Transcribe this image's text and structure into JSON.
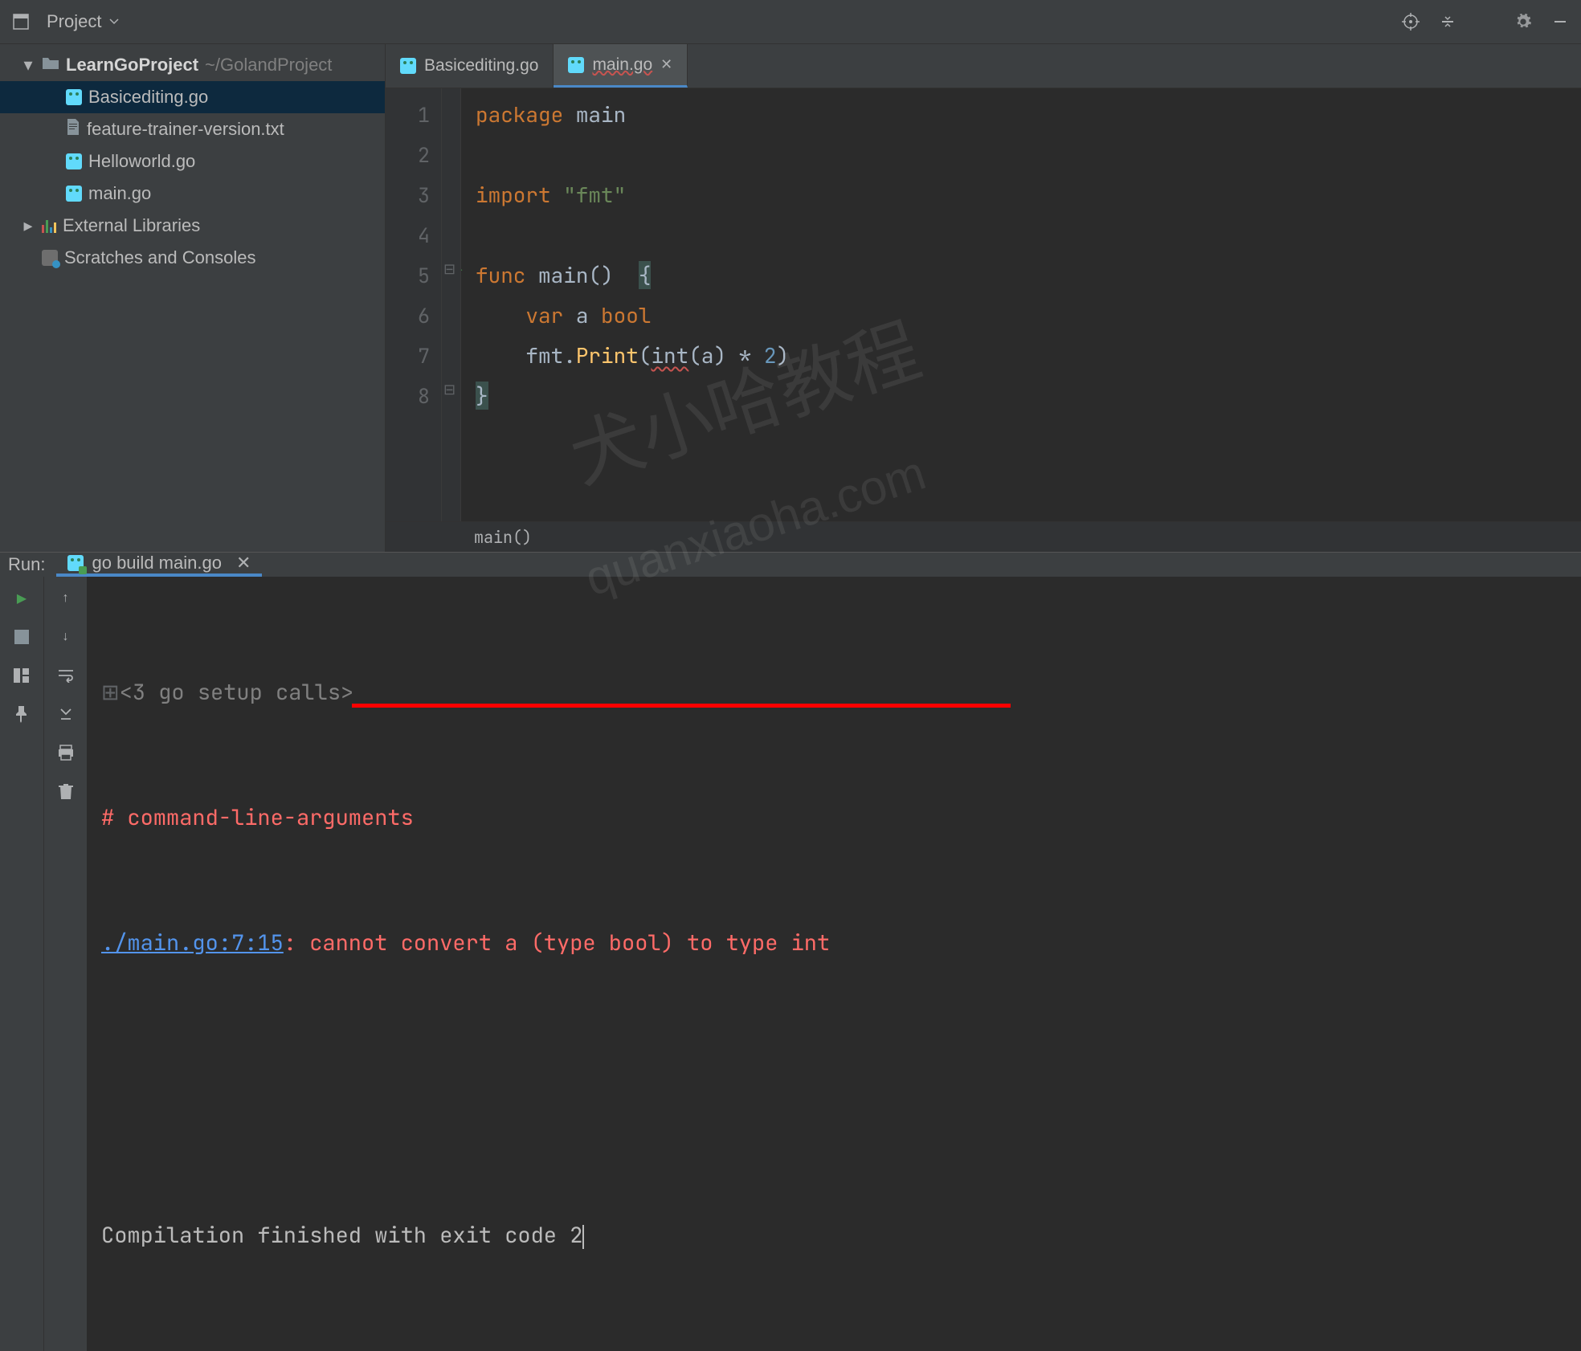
{
  "toolbar": {
    "project_label": "Project"
  },
  "tree": {
    "root": {
      "name": "LearnGoProject",
      "hint": "~/GolandProject"
    },
    "files": [
      {
        "name": "Basicediting.go",
        "type": "go",
        "selected": true
      },
      {
        "name": "feature-trainer-version.txt",
        "type": "txt",
        "selected": false
      },
      {
        "name": "Helloworld.go",
        "type": "go",
        "selected": false
      },
      {
        "name": "main.go",
        "type": "go",
        "selected": false
      }
    ],
    "ext_lib": "External Libraries",
    "scratches": "Scratches and Consoles"
  },
  "tabs": [
    {
      "name": "Basicediting.go",
      "active": false
    },
    {
      "name": "main.go",
      "active": true
    }
  ],
  "code": {
    "lines": [
      {
        "n": 1,
        "tokens": [
          [
            "kw",
            "package "
          ],
          [
            "id",
            "main"
          ]
        ]
      },
      {
        "n": 2,
        "tokens": []
      },
      {
        "n": 3,
        "tokens": [
          [
            "kw",
            "import "
          ],
          [
            "str",
            "\"fmt\""
          ]
        ]
      },
      {
        "n": 4,
        "tokens": []
      },
      {
        "n": 5,
        "tokens": [
          [
            "kw",
            "func "
          ],
          [
            "id",
            "main"
          ],
          [
            "br",
            "()  "
          ],
          [
            "hlbr",
            "{"
          ]
        ]
      },
      {
        "n": 6,
        "tokens": [
          [
            "pad",
            "    "
          ],
          [
            "kw",
            "var "
          ],
          [
            "id",
            "a "
          ],
          [
            "kw",
            "bool"
          ]
        ]
      },
      {
        "n": 7,
        "tokens": [
          [
            "pad",
            "    "
          ],
          [
            "id",
            "fmt"
          ],
          [
            "br",
            "."
          ],
          [
            "fn",
            "Print"
          ],
          [
            "br",
            "("
          ],
          [
            "err",
            "int"
          ],
          [
            "br",
            "(a) "
          ],
          [
            "id",
            "* "
          ],
          [
            "num",
            "2"
          ],
          [
            "br",
            ")"
          ]
        ]
      },
      {
        "n": 8,
        "tokens": [
          [
            "hlbr",
            "}"
          ]
        ]
      }
    ]
  },
  "breadcrumb": "main()",
  "run": {
    "label": "Run:",
    "tab": "go build main.go",
    "lines": {
      "setup": "<3 go setup calls>",
      "err1": "# command-line-arguments",
      "link": "./main.go:7:15",
      "err2": ": cannot convert a (type bool) to type int",
      "done": "Compilation finished with exit code 2"
    }
  },
  "watermarks": {
    "w1": "犬小哈教程",
    "w2": "quanxiaoha.com"
  }
}
